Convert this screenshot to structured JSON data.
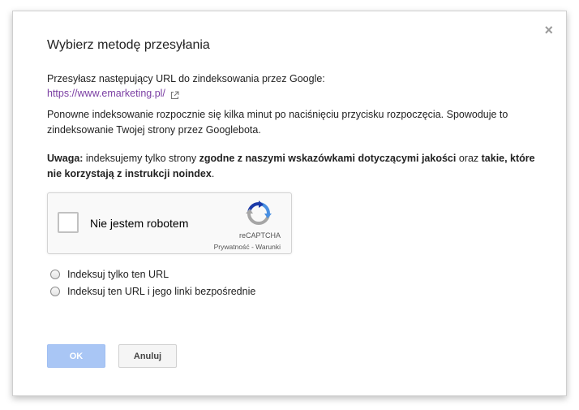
{
  "dialog": {
    "title": "Wybierz metodę przesyłania",
    "close_symbol": "×",
    "intro_text": "Przesyłasz następujący URL do zindeksowania przez Google:",
    "url": "https://www.emarketing.pl/",
    "reindex_text": "Ponowne indeksowanie rozpocznie się kilka minut po naciśnięciu przycisku rozpoczęcia. Spowoduje to zindeksowanie Twojej strony przez Googlebota.",
    "note": {
      "label": "Uwaga:",
      "part1": " indeksujemy tylko strony ",
      "bold1": "zgodne z naszymi wskazówkami dotyczącymi jakości",
      "part2": " oraz ",
      "bold2": "takie, które nie korzystają z instrukcji noindex",
      "part3": "."
    }
  },
  "captcha": {
    "label": "Nie jestem robotem",
    "brand": "reCAPTCHA",
    "privacy": "Prywatność",
    "separator": " - ",
    "terms": "Warunki",
    "icon": "recaptcha-logo-icon"
  },
  "options": [
    {
      "label": "Indeksuj tylko ten URL",
      "selected": false
    },
    {
      "label": "Indeksuj ten URL i jego linki bezpośrednie",
      "selected": false
    }
  ],
  "buttons": {
    "ok": "OK",
    "cancel": "Anuluj"
  },
  "colors": {
    "link": "#7b3fa3",
    "ok_button": "#a9c6f5",
    "recaptcha_blue": "#4a90e2",
    "recaptcha_gray": "#a6a6a6"
  }
}
